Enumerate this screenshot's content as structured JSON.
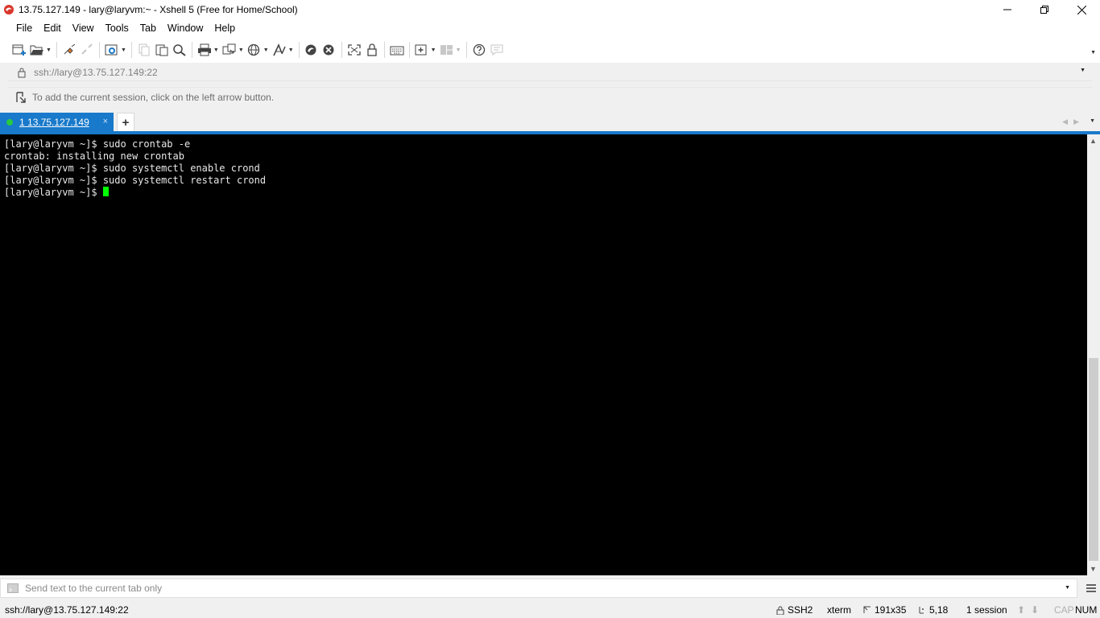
{
  "window": {
    "title": "13.75.127.149 - lary@laryvm:~ - Xshell 5 (Free for Home/School)"
  },
  "menu": {
    "items": [
      "File",
      "Edit",
      "View",
      "Tools",
      "Tab",
      "Window",
      "Help"
    ]
  },
  "address": {
    "url": "ssh://lary@13.75.127.149:22"
  },
  "session_hint": "To add the current session, click on the left arrow button.",
  "tab": {
    "number": "1",
    "label": "13.75.127.149",
    "close": "×",
    "add": "+"
  },
  "terminal": {
    "lines": [
      "[lary@laryvm ~]$ sudo crontab -e",
      "crontab: installing new crontab",
      "[lary@laryvm ~]$ sudo systemctl enable crond",
      "[lary@laryvm ~]$ sudo systemctl restart crond",
      "[lary@laryvm ~]$ "
    ],
    "cursor_color": "#00ff00"
  },
  "send": {
    "placeholder": "Send text to the current tab only"
  },
  "status": {
    "connection": "ssh://lary@13.75.127.149:22",
    "protocol": "SSH2",
    "term_type": "xterm",
    "size": "191x35",
    "cursor_pos": "5,18",
    "sessions": "1 session",
    "cap": "CAP",
    "num": "NUM"
  },
  "colors": {
    "accent": "#1979ca",
    "tab_dot": "#27c93f"
  }
}
